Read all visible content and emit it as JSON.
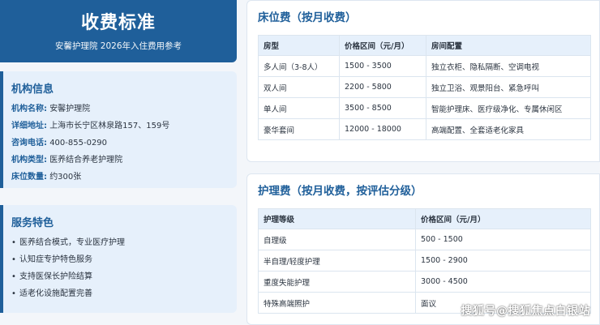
{
  "header": {
    "title": "收费标准",
    "subtitle": "安馨护理院 2026年入住费用参考"
  },
  "institution": {
    "title": "机构信息",
    "rows": [
      {
        "label": "机构名称:",
        "value": "安馨护理院"
      },
      {
        "label": "详细地址:",
        "value": "上海市长宁区林泉路157、159号"
      },
      {
        "label": "咨询电话:",
        "value": "400-855-0290"
      },
      {
        "label": "机构类型:",
        "value": "医养结合养老护理院"
      },
      {
        "label": "床位数量:",
        "value": "约300张"
      }
    ]
  },
  "services": {
    "title": "服务特色",
    "bullet": "•",
    "items": [
      "医养结合模式，专业医疗护理",
      "认知症专护特色服务",
      "支持医保长护险结算",
      "适老化设施配置完善"
    ]
  },
  "bed_fee": {
    "title": "床位费（按月收费）",
    "headers": [
      "房型",
      "价格区间（元/月）",
      "房间配置"
    ],
    "rows": [
      [
        "多人间（3-8人）",
        "1500 - 3500",
        "独立衣柜、隐私隔断、空调电视"
      ],
      [
        "双人间",
        "2200 - 5800",
        "独立卫浴、观景阳台、紧急呼叫"
      ],
      [
        "单人间",
        "3500 - 8500",
        "智能护理床、医疗级净化、专属休闲区"
      ],
      [
        "豪华套间",
        "12000 - 18000",
        "高端配置、全套适老化家具"
      ]
    ]
  },
  "care_fee": {
    "title": "护理费（按月收费，按评估分级）",
    "headers": [
      "护理等级",
      "价格区间（元/月）"
    ],
    "rows": [
      [
        "自理级",
        "500 - 1500"
      ],
      [
        "半自理/轻度护理",
        "1500 - 2900"
      ],
      [
        "重度失能护理",
        "3000 - 4500"
      ],
      [
        "特殊高端照护",
        "面议"
      ]
    ]
  },
  "watermark": "搜狐号@搜狐焦点白银站",
  "colors": {
    "primary": "#1f5f9a",
    "panel_bg": "#e6f0fb",
    "page_bg": "#f3f6fa"
  }
}
